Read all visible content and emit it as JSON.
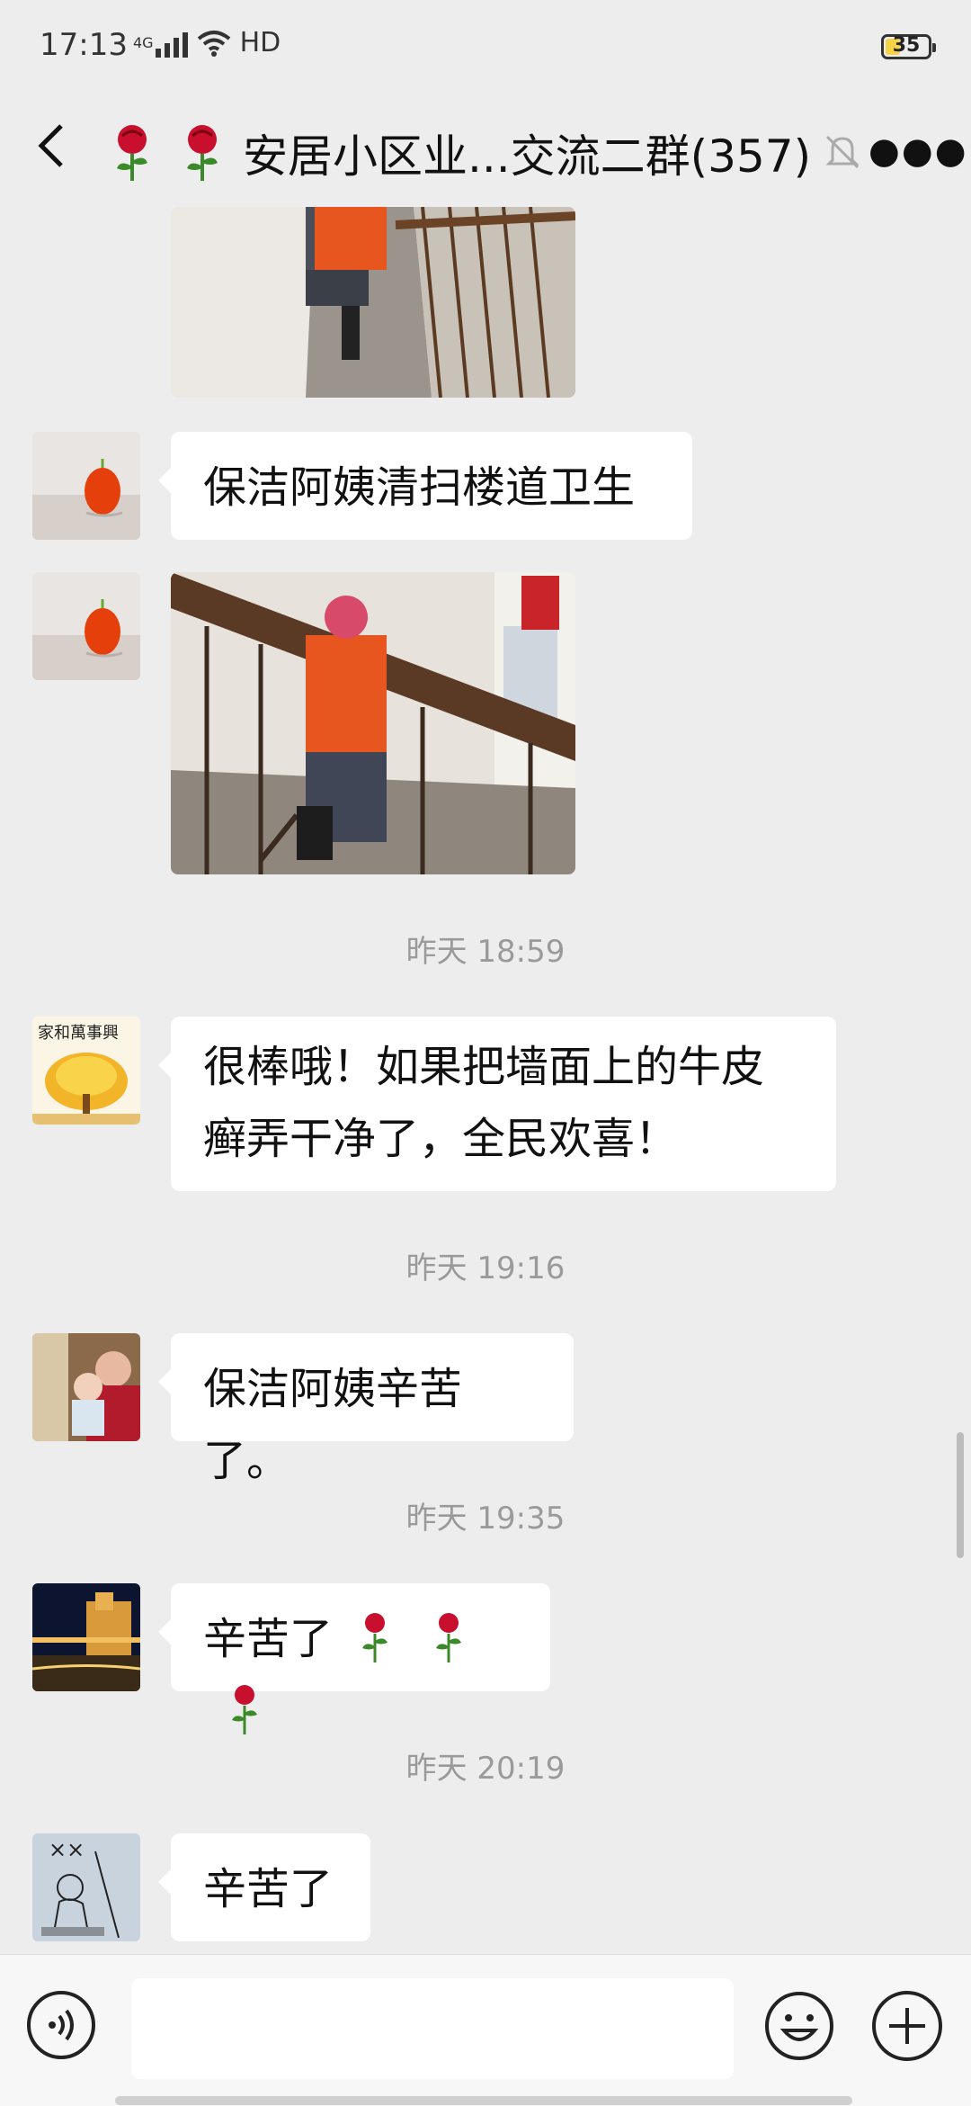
{
  "status_bar": {
    "time": "17:13",
    "network": "4G",
    "hd": "HD",
    "battery": "35",
    "battery_level": 0.35
  },
  "header": {
    "title": "安居小区业...交流二群(357)"
  },
  "messages": [
    {
      "type": "text",
      "text": "保洁阿姨清扫楼道卫生"
    },
    {
      "type": "image"
    }
  ],
  "timestamps": [
    "昨天 18:59",
    "昨天 19:16",
    "昨天 19:35",
    "昨天 20:19"
  ],
  "replies": [
    {
      "line1": "很棒哦！如果把墙面上的牛皮",
      "line2": "癣弄干净了，全民欢喜！"
    },
    {
      "text": "保洁阿姨辛苦了。"
    },
    {
      "text": "辛苦了"
    },
    {
      "text": "辛苦了"
    }
  ],
  "avatar_text": {
    "calligraphy": "家和萬事興",
    "x_marks": "××"
  },
  "colors": {
    "background": "#ededed",
    "bubble": "#ffffff",
    "timestamp": "#9a9a9a",
    "rose": "#c8102e"
  },
  "icons": [
    "back-arrow-icon",
    "rose-icon",
    "bell-muted-icon",
    "more-icon",
    "voice-icon",
    "emoji-icon",
    "plus-icon"
  ]
}
